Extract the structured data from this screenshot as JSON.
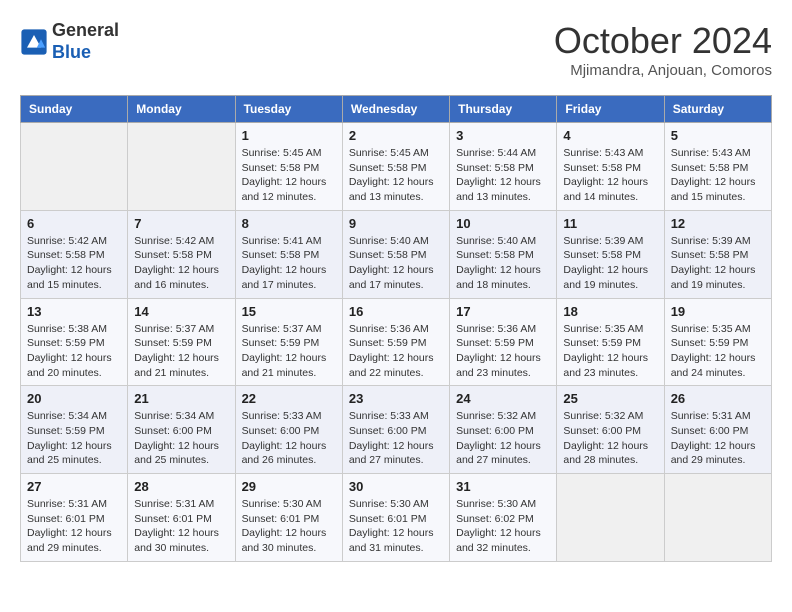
{
  "header": {
    "logo_general": "General",
    "logo_blue": "Blue",
    "month_year": "October 2024",
    "location": "Mjimandra, Anjouan, Comoros"
  },
  "weekdays": [
    "Sunday",
    "Monday",
    "Tuesday",
    "Wednesday",
    "Thursday",
    "Friday",
    "Saturday"
  ],
  "weeks": [
    [
      {
        "day": "",
        "sunrise": "",
        "sunset": "",
        "daylight": ""
      },
      {
        "day": "",
        "sunrise": "",
        "sunset": "",
        "daylight": ""
      },
      {
        "day": "1",
        "sunrise": "Sunrise: 5:45 AM",
        "sunset": "Sunset: 5:58 PM",
        "daylight": "Daylight: 12 hours and 12 minutes."
      },
      {
        "day": "2",
        "sunrise": "Sunrise: 5:45 AM",
        "sunset": "Sunset: 5:58 PM",
        "daylight": "Daylight: 12 hours and 13 minutes."
      },
      {
        "day": "3",
        "sunrise": "Sunrise: 5:44 AM",
        "sunset": "Sunset: 5:58 PM",
        "daylight": "Daylight: 12 hours and 13 minutes."
      },
      {
        "day": "4",
        "sunrise": "Sunrise: 5:43 AM",
        "sunset": "Sunset: 5:58 PM",
        "daylight": "Daylight: 12 hours and 14 minutes."
      },
      {
        "day": "5",
        "sunrise": "Sunrise: 5:43 AM",
        "sunset": "Sunset: 5:58 PM",
        "daylight": "Daylight: 12 hours and 15 minutes."
      }
    ],
    [
      {
        "day": "6",
        "sunrise": "Sunrise: 5:42 AM",
        "sunset": "Sunset: 5:58 PM",
        "daylight": "Daylight: 12 hours and 15 minutes."
      },
      {
        "day": "7",
        "sunrise": "Sunrise: 5:42 AM",
        "sunset": "Sunset: 5:58 PM",
        "daylight": "Daylight: 12 hours and 16 minutes."
      },
      {
        "day": "8",
        "sunrise": "Sunrise: 5:41 AM",
        "sunset": "Sunset: 5:58 PM",
        "daylight": "Daylight: 12 hours and 17 minutes."
      },
      {
        "day": "9",
        "sunrise": "Sunrise: 5:40 AM",
        "sunset": "Sunset: 5:58 PM",
        "daylight": "Daylight: 12 hours and 17 minutes."
      },
      {
        "day": "10",
        "sunrise": "Sunrise: 5:40 AM",
        "sunset": "Sunset: 5:58 PM",
        "daylight": "Daylight: 12 hours and 18 minutes."
      },
      {
        "day": "11",
        "sunrise": "Sunrise: 5:39 AM",
        "sunset": "Sunset: 5:58 PM",
        "daylight": "Daylight: 12 hours and 19 minutes."
      },
      {
        "day": "12",
        "sunrise": "Sunrise: 5:39 AM",
        "sunset": "Sunset: 5:58 PM",
        "daylight": "Daylight: 12 hours and 19 minutes."
      }
    ],
    [
      {
        "day": "13",
        "sunrise": "Sunrise: 5:38 AM",
        "sunset": "Sunset: 5:59 PM",
        "daylight": "Daylight: 12 hours and 20 minutes."
      },
      {
        "day": "14",
        "sunrise": "Sunrise: 5:37 AM",
        "sunset": "Sunset: 5:59 PM",
        "daylight": "Daylight: 12 hours and 21 minutes."
      },
      {
        "day": "15",
        "sunrise": "Sunrise: 5:37 AM",
        "sunset": "Sunset: 5:59 PM",
        "daylight": "Daylight: 12 hours and 21 minutes."
      },
      {
        "day": "16",
        "sunrise": "Sunrise: 5:36 AM",
        "sunset": "Sunset: 5:59 PM",
        "daylight": "Daylight: 12 hours and 22 minutes."
      },
      {
        "day": "17",
        "sunrise": "Sunrise: 5:36 AM",
        "sunset": "Sunset: 5:59 PM",
        "daylight": "Daylight: 12 hours and 23 minutes."
      },
      {
        "day": "18",
        "sunrise": "Sunrise: 5:35 AM",
        "sunset": "Sunset: 5:59 PM",
        "daylight": "Daylight: 12 hours and 23 minutes."
      },
      {
        "day": "19",
        "sunrise": "Sunrise: 5:35 AM",
        "sunset": "Sunset: 5:59 PM",
        "daylight": "Daylight: 12 hours and 24 minutes."
      }
    ],
    [
      {
        "day": "20",
        "sunrise": "Sunrise: 5:34 AM",
        "sunset": "Sunset: 5:59 PM",
        "daylight": "Daylight: 12 hours and 25 minutes."
      },
      {
        "day": "21",
        "sunrise": "Sunrise: 5:34 AM",
        "sunset": "Sunset: 6:00 PM",
        "daylight": "Daylight: 12 hours and 25 minutes."
      },
      {
        "day": "22",
        "sunrise": "Sunrise: 5:33 AM",
        "sunset": "Sunset: 6:00 PM",
        "daylight": "Daylight: 12 hours and 26 minutes."
      },
      {
        "day": "23",
        "sunrise": "Sunrise: 5:33 AM",
        "sunset": "Sunset: 6:00 PM",
        "daylight": "Daylight: 12 hours and 27 minutes."
      },
      {
        "day": "24",
        "sunrise": "Sunrise: 5:32 AM",
        "sunset": "Sunset: 6:00 PM",
        "daylight": "Daylight: 12 hours and 27 minutes."
      },
      {
        "day": "25",
        "sunrise": "Sunrise: 5:32 AM",
        "sunset": "Sunset: 6:00 PM",
        "daylight": "Daylight: 12 hours and 28 minutes."
      },
      {
        "day": "26",
        "sunrise": "Sunrise: 5:31 AM",
        "sunset": "Sunset: 6:00 PM",
        "daylight": "Daylight: 12 hours and 29 minutes."
      }
    ],
    [
      {
        "day": "27",
        "sunrise": "Sunrise: 5:31 AM",
        "sunset": "Sunset: 6:01 PM",
        "daylight": "Daylight: 12 hours and 29 minutes."
      },
      {
        "day": "28",
        "sunrise": "Sunrise: 5:31 AM",
        "sunset": "Sunset: 6:01 PM",
        "daylight": "Daylight: 12 hours and 30 minutes."
      },
      {
        "day": "29",
        "sunrise": "Sunrise: 5:30 AM",
        "sunset": "Sunset: 6:01 PM",
        "daylight": "Daylight: 12 hours and 30 minutes."
      },
      {
        "day": "30",
        "sunrise": "Sunrise: 5:30 AM",
        "sunset": "Sunset: 6:01 PM",
        "daylight": "Daylight: 12 hours and 31 minutes."
      },
      {
        "day": "31",
        "sunrise": "Sunrise: 5:30 AM",
        "sunset": "Sunset: 6:02 PM",
        "daylight": "Daylight: 12 hours and 32 minutes."
      },
      {
        "day": "",
        "sunrise": "",
        "sunset": "",
        "daylight": ""
      },
      {
        "day": "",
        "sunrise": "",
        "sunset": "",
        "daylight": ""
      }
    ]
  ]
}
